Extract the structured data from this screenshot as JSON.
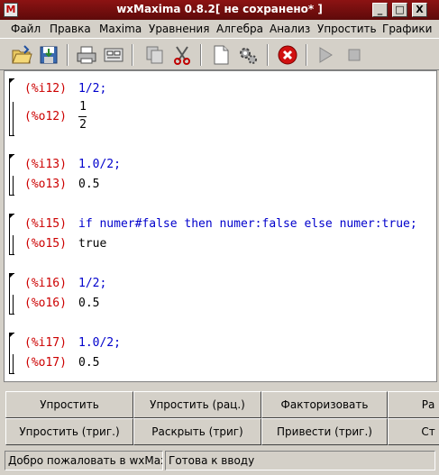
{
  "window": {
    "title": "wxMaxima 0.8.2[ не сохранено* ]",
    "icon_letter": "M",
    "minimize_glyph": "_",
    "maximize_glyph": "□",
    "close_glyph": "X"
  },
  "menu": [
    {
      "label": "Файл"
    },
    {
      "label": "Правка"
    },
    {
      "label": "Maxima"
    },
    {
      "label": "Уравнения"
    },
    {
      "label": "Алгебра"
    },
    {
      "label": "Анализ"
    },
    {
      "label": "Упростить"
    },
    {
      "label": "Графики"
    }
  ],
  "toolbar": {
    "icons": [
      "open-folder-icon",
      "save-icon",
      "print-icon",
      "config-icon",
      "copy-icon",
      "cut-icon",
      "new-page-icon",
      "gear-icon",
      "interrupt-icon",
      "play-icon",
      "stop-icon"
    ]
  },
  "cells": [
    {
      "in_label": "(%i12)",
      "in_text": "1/2;",
      "out_label": "(%o12)",
      "out_num": "1",
      "out_den": "2"
    },
    {
      "in_label": "(%i13)",
      "in_text": "1.0/2;",
      "out_label": "(%o13)",
      "out_text": "0.5"
    },
    {
      "in_label": "(%i15)",
      "in_text": "if numer#false then numer:false else numer:true;",
      "out_label": "(%o15)",
      "out_text": "true"
    },
    {
      "in_label": "(%i16)",
      "in_text": "1/2;",
      "out_label": "(%o16)",
      "out_text": "0.5"
    },
    {
      "in_label": "(%i17)",
      "in_text": "1.0/2;",
      "out_label": "(%o17)",
      "out_text": "0.5"
    }
  ],
  "buttons": {
    "row1": [
      "Упростить",
      "Упростить (рац.)",
      "Факторизовать",
      "Ра"
    ],
    "row2": [
      "Упростить (триг.)",
      "Раскрыть (триг)",
      "Привести (триг.)",
      "Ст"
    ]
  },
  "status": {
    "message": "Добро пожаловать в wxMaxi",
    "state": "Готова к вводу"
  },
  "colors": {
    "input_label": "#cc0000",
    "input_text": "#0000cc",
    "titlebar": "#7a1010"
  }
}
